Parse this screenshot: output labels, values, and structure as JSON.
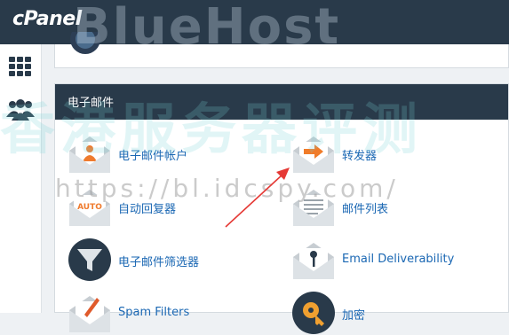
{
  "app": {
    "logo_text": "cPanel"
  },
  "sidebar": {
    "items": [
      {
        "icon": "grid-icon"
      },
      {
        "icon": "users-icon"
      }
    ]
  },
  "email_section": {
    "title": "电子邮件",
    "items": [
      {
        "label": "电子邮件帐户",
        "icon": "email-account-icon"
      },
      {
        "label": "转发器",
        "icon": "forwarder-icon"
      },
      {
        "label": "自动回复器",
        "icon": "autoresponder-icon"
      },
      {
        "label": "邮件列表",
        "icon": "mailing-list-icon"
      },
      {
        "label": "电子邮件筛选器",
        "icon": "email-filter-icon"
      },
      {
        "label": "Email Deliverability",
        "icon": "email-deliverability-icon"
      },
      {
        "label": "Spam Filters",
        "icon": "spam-filter-icon"
      },
      {
        "label": "加密",
        "icon": "encryption-icon"
      }
    ]
  },
  "autoresponder_badge": "AUTO",
  "watermarks": {
    "brand": "BlueHost",
    "cn": "香港服务器评测",
    "url": "https://bl.idcspy.com/"
  },
  "colors": {
    "topbar": "#293a4a",
    "link": "#1a67b3",
    "arrow": "#e53935",
    "forward_arrow": "#f07c2a"
  }
}
